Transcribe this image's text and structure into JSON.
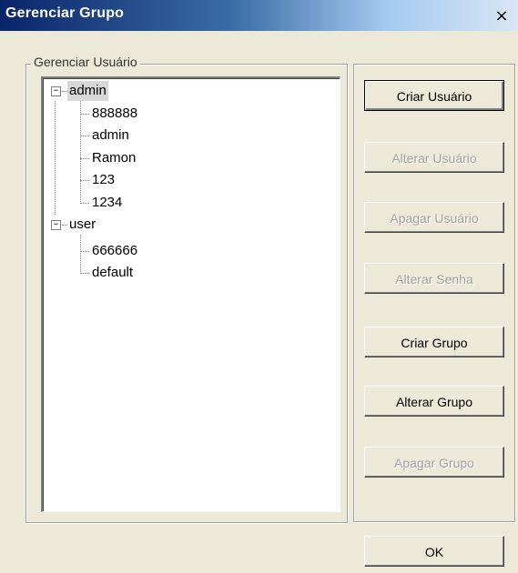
{
  "window": {
    "title": "Gerenciar Grupo",
    "close_glyph": "×"
  },
  "groupbox": {
    "label": "Gerenciar Usuário"
  },
  "tree": {
    "groups": [
      {
        "label": "admin",
        "expanded": true,
        "selected": true,
        "children": [
          "888888",
          "admin",
          "Ramon",
          "123",
          "1234"
        ]
      },
      {
        "label": "user",
        "expanded": true,
        "selected": false,
        "children": [
          "666666",
          "default"
        ]
      }
    ],
    "expander_glyph": "−"
  },
  "buttons": {
    "criar_usuario": "Criar Usuário",
    "alterar_usuario": "Alterar Usuário",
    "apagar_usuario": "Apagar Usuário",
    "alterar_senha": "Alterar Senha",
    "criar_grupo": "Criar Grupo",
    "alterar_grupo": "Alterar Grupo",
    "apagar_grupo": "Apagar Grupo",
    "ok": "OK"
  },
  "button_states": {
    "criar_usuario": "enabled",
    "alterar_usuario": "disabled",
    "apagar_usuario": "disabled",
    "alterar_senha": "disabled",
    "criar_grupo": "enabled",
    "alterar_grupo": "enabled",
    "apagar_grupo": "disabled",
    "ok": "enabled"
  },
  "colors": {
    "title_bar_start": "#0a246a",
    "dialog_face": "#ece9d8",
    "disabled_text": "#a0a0a0"
  }
}
